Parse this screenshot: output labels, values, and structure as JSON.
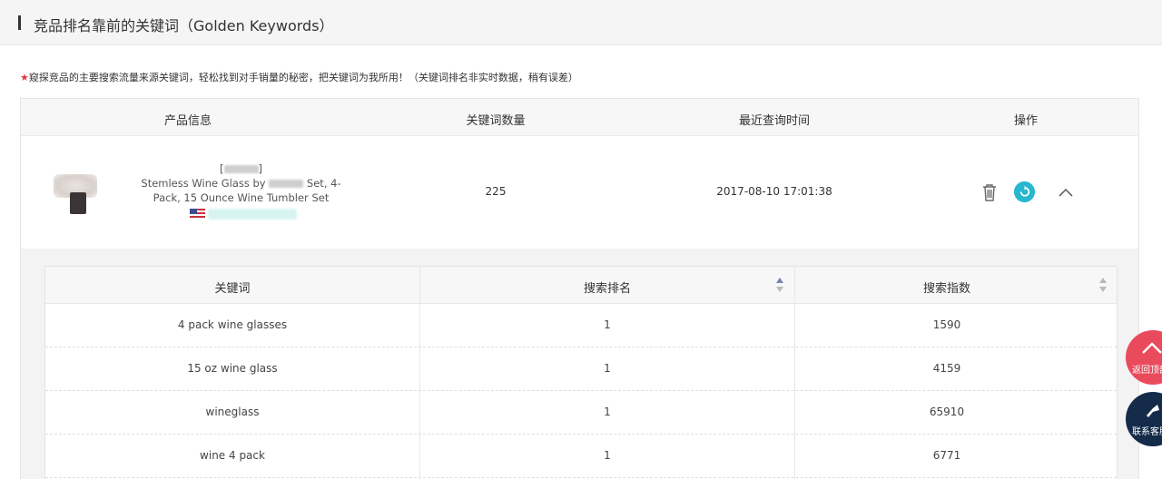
{
  "section": {
    "title": "竞品排名靠前的关键词（Golden Keywords）"
  },
  "notice": {
    "star": "★",
    "text": "窥探竞品的主要搜索流量来源关键词，轻松找到对手销量的秘密，把关键词为我所用！（关键词排名非实时数据，稍有误差）"
  },
  "product_table": {
    "headers": [
      "产品信息",
      "关键词数量",
      "最近查询时间",
      "操作"
    ],
    "row": {
      "brand_prefix": "[",
      "brand_suffix": "]",
      "title_part1": "Stemless Wine Glass by ",
      "title_part2": " Set, 4-",
      "title_line2": "Pack, 15 Ounce Wine Tumbler Set",
      "keyword_count": "225",
      "last_query_time": "2017-08-10 17:01:38"
    }
  },
  "keyword_table": {
    "headers": [
      "关键词",
      "搜索排名",
      "搜索指数"
    ],
    "rows": [
      {
        "keyword": "4 pack wine glasses",
        "rank": "1",
        "index": "1590"
      },
      {
        "keyword": "15 oz wine glass",
        "rank": "1",
        "index": "4159"
      },
      {
        "keyword": "wineglass",
        "rank": "1",
        "index": "65910"
      },
      {
        "keyword": "wine 4 pack",
        "rank": "1",
        "index": "6771"
      }
    ]
  },
  "floating": {
    "back_to_top": "返回顶部",
    "contact": "联系客服"
  },
  "colors": {
    "accent_teal": "#27b8cf",
    "float_red": "#e94b5d",
    "float_navy": "#142c4a",
    "star_red": "#e8383d"
  }
}
